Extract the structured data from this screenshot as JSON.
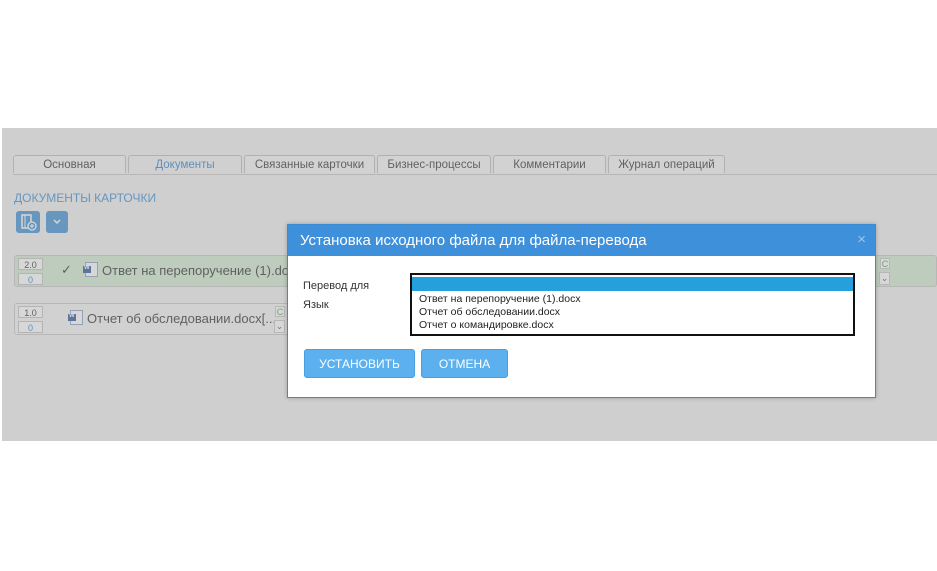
{
  "tabs": [
    {
      "label": "Основная",
      "active": false
    },
    {
      "label": "Документы",
      "active": true
    },
    {
      "label": "Связанные карточки",
      "active": false
    },
    {
      "label": "Бизнес-процессы",
      "active": false
    },
    {
      "label": "Комментарии",
      "active": false
    },
    {
      "label": "Журнал операций",
      "active": false
    }
  ],
  "section_title": "ДОКУМЕНТЫ КАРТОЧКИ",
  "documents": [
    {
      "version": "2.0",
      "sub_version": "0",
      "name": "Ответ на перепоручение (1).do...",
      "checked": true
    },
    {
      "version": "1.0",
      "sub_version": "0",
      "name": "Отчет об обследовании.docx[...",
      "checked": false
    }
  ],
  "dialog": {
    "title": "Установка исходного файла для файла-перевода",
    "close_glyph": "×",
    "label_translation_for": "Перевод для",
    "label_language": "Язык",
    "options": [
      "",
      "Ответ на перепоручение (1).docx",
      "Отчет об обследовании.docx",
      "Отчет о командировке.docx"
    ],
    "selected_index": 0,
    "set_button": "УСТАНОВИТЬ",
    "cancel_button": "ОТМЕНА"
  },
  "colors": {
    "accent": "#3d90d9",
    "button": "#5cb0ee",
    "selected_row": "#d2ecd0",
    "selected_option": "#26a0dc"
  },
  "icons": [
    "attach-document-icon",
    "chevron-down-icon",
    "check-icon",
    "word-document-icon",
    "close-icon"
  ]
}
